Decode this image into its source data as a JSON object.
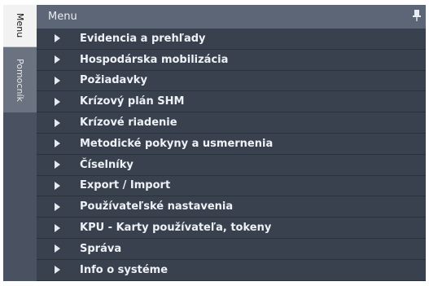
{
  "tabs": [
    {
      "label": "Menu"
    },
    {
      "label": "Pomocník"
    }
  ],
  "header": {
    "title": "Menu"
  },
  "menu": {
    "items": [
      {
        "label": "Evidencia a prehľady"
      },
      {
        "label": "Hospodárska mobilizácia"
      },
      {
        "label": "Požiadavky"
      },
      {
        "label": "Krízový plán SHM"
      },
      {
        "label": "Krízové riadenie"
      },
      {
        "label": "Metodické pokyny a usmernenia"
      },
      {
        "label": "Číselníky"
      },
      {
        "label": "Export / Import"
      },
      {
        "label": "Používateľské nastavenia"
      },
      {
        "label": "KPU - Karty používateľa, tokeny"
      },
      {
        "label": "Správa"
      },
      {
        "label": "Info o systéme"
      }
    ]
  },
  "icons": {
    "pin": "pin-icon",
    "expand": "chevron-right-icon"
  },
  "colors": {
    "panel": "#3b4250",
    "header": "#5d6676",
    "text": "#eef1f5"
  }
}
